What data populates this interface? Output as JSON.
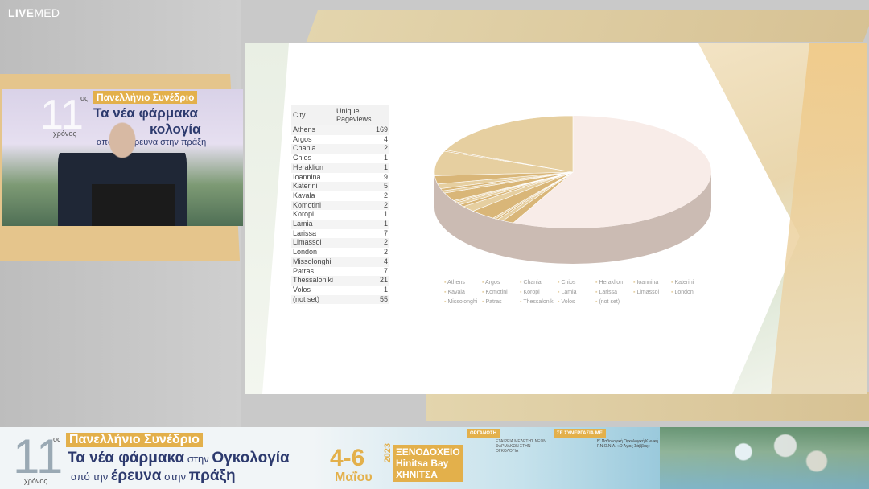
{
  "brand": {
    "bold": "LIVE",
    "thin": "MED"
  },
  "camera": {
    "number": "11",
    "sup": "ος",
    "years": "χρόνος",
    "badge": "Πανελλήνιο Συνέδριο",
    "line1": "Τα νέα φάρμακα",
    "line2": "κολογία",
    "line3": "από την έρευνα στην πράξη"
  },
  "table": {
    "headers": [
      "City",
      "Unique Pageviews"
    ],
    "rows": [
      [
        "Athens",
        "169"
      ],
      [
        "Argos",
        "4"
      ],
      [
        "Chania",
        "2"
      ],
      [
        "Chios",
        "1"
      ],
      [
        "Heraklion",
        "1"
      ],
      [
        "Ioannina",
        "9"
      ],
      [
        "Katerini",
        "5"
      ],
      [
        "Kavala",
        "2"
      ],
      [
        "Komotini",
        "2"
      ],
      [
        "Koropi",
        "1"
      ],
      [
        "Lamia",
        "1"
      ],
      [
        "Larissa",
        "7"
      ],
      [
        "Limassol",
        "2"
      ],
      [
        "London",
        "2"
      ],
      [
        "Missolonghi",
        "4"
      ],
      [
        "Patras",
        "7"
      ],
      [
        "Thessaloniki",
        "21"
      ],
      [
        "Volos",
        "1"
      ],
      [
        "(not set)",
        "55"
      ]
    ]
  },
  "chart_data": {
    "type": "pie",
    "categories": [
      "Athens",
      "Argos",
      "Chania",
      "Chios",
      "Heraklion",
      "Ioannina",
      "Katerini",
      "Kavala",
      "Komotini",
      "Koropi",
      "Lamia",
      "Larissa",
      "Limassol",
      "London",
      "Missolonghi",
      "Patras",
      "Thessaloniki",
      "Volos",
      "(not set)"
    ],
    "values": [
      169,
      4,
      2,
      1,
      1,
      9,
      5,
      2,
      2,
      1,
      1,
      7,
      2,
      2,
      4,
      7,
      21,
      1,
      55
    ],
    "legend_position": "bottom",
    "colors": {
      "main": "#f8ece8",
      "accent": "#d9b678",
      "side": "#cbbbb3"
    }
  },
  "footer": {
    "number": "11",
    "sup": "ος",
    "years": "χρόνος",
    "badge": "Πανελλήνιο Συνέδριο",
    "line1a": "Τα νέα φάρμακα",
    "line1b": " στην ",
    "line1c": "Ογκολογία",
    "line2a": "από την ",
    "line2b": "έρευνα",
    "line2c": " στην ",
    "line2d": "πράξη",
    "date": "4-6",
    "month": "Μαΐου",
    "year": "2023",
    "hotel1": "ΞΕΝΟΔΟΧΕΙΟ",
    "hotel2": "Hinitsa Bay",
    "hotel3": "ΧΗΝΙΤΣΑ",
    "org": "ΟΡΓΑΝΩΣΗ",
    "org_text": "ΕΤΑΙΡΕΙΑ ΜΕΛΕΤΗΣ ΝΕΩΝ ΦΑΡΜΑΚΩΝ ΣΤΗΝ ΟΓΚΟΛΟΓΙΑ",
    "coop": "ΣΕ ΣΥΝΕΡΓΑΣΙΑ ΜΕ",
    "coop_text": "Β' Παθολογική Ογκολογική Κλινική Γ.Ν.Ο.Ν.Α. «Ο Άγιος Σάββας»"
  }
}
